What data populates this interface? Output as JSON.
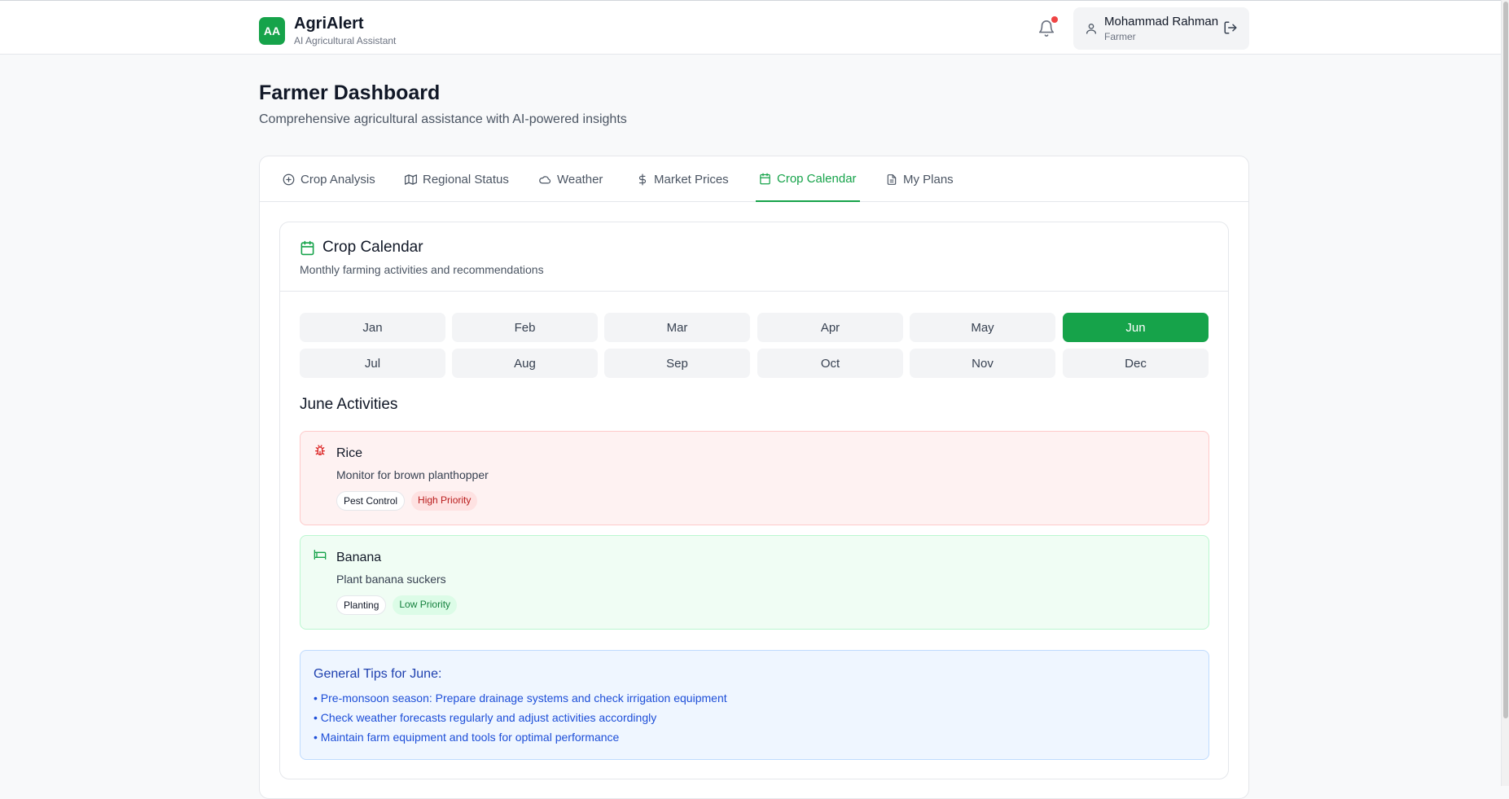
{
  "header": {
    "logo_text": "AA",
    "app_name": "AgriAlert",
    "app_subtitle": "AI Agricultural Assistant",
    "user_name": "Mohammad Rahman",
    "user_role": "Farmer"
  },
  "page": {
    "title": "Farmer Dashboard",
    "subtitle": "Comprehensive agricultural assistance with AI-powered insights"
  },
  "tabs": [
    {
      "label": "Crop Analysis",
      "icon": "plus-circle-icon"
    },
    {
      "label": "Regional Status",
      "icon": "map-icon"
    },
    {
      "label": "Weather",
      "icon": "cloud-icon"
    },
    {
      "label": "Market Prices",
      "icon": "dollar-icon"
    },
    {
      "label": "Crop Calendar",
      "icon": "calendar-icon",
      "active": true
    },
    {
      "label": "My Plans",
      "icon": "document-icon"
    }
  ],
  "calendar": {
    "title": "Crop Calendar",
    "subtitle": "Monthly farming activities and recommendations",
    "months": [
      "Jan",
      "Feb",
      "Mar",
      "Apr",
      "May",
      "Jun",
      "Jul",
      "Aug",
      "Sep",
      "Oct",
      "Nov",
      "Dec"
    ],
    "selected_month": "Jun",
    "activities_title": "June Activities",
    "activities": [
      {
        "crop": "Rice",
        "description": "Monitor for brown planthopper",
        "type": "Pest Control",
        "priority": "High Priority",
        "icon": "bug-icon",
        "color": "#dc2626"
      },
      {
        "crop": "Banana",
        "description": "Plant banana suckers",
        "type": "Planting",
        "priority": "Low Priority",
        "icon": "bed-icon",
        "color": "#16a34a"
      }
    ],
    "tips": {
      "title": "General Tips for June:",
      "items": [
        "• Pre-monsoon season: Prepare drainage systems and check irrigation equipment",
        "• Check weather forecasts regularly and adjust activities accordingly",
        "• Maintain farm equipment and tools for optimal performance"
      ]
    }
  },
  "colors": {
    "accent": "#16a34a",
    "alert_dot": "#ef4444"
  }
}
